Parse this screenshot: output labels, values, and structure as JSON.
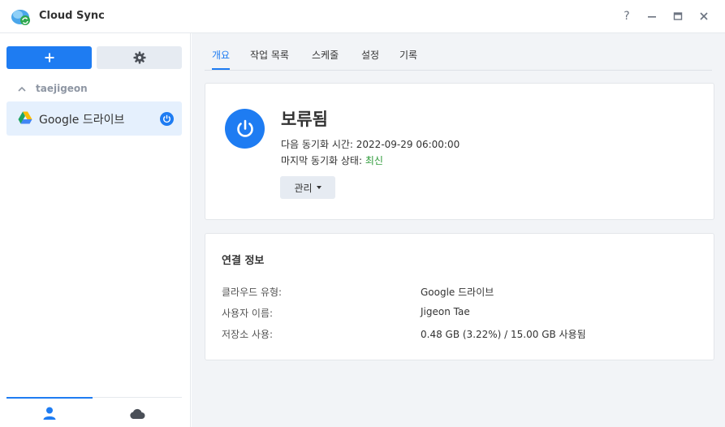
{
  "window": {
    "title": "Cloud Sync",
    "help_glyph": "?",
    "minimize_glyph": "—",
    "maximize_glyph": "▭",
    "close_glyph": "✕"
  },
  "sidebar": {
    "add_button_glyph": "+",
    "settings_icon": "gear-icon",
    "user_group": "taejigeon",
    "tasks": [
      {
        "label": "Google 드라이브",
        "icon": "google-drive-icon",
        "status_icon": "power-icon"
      }
    ],
    "bottom_tabs": [
      {
        "icon": "user-icon",
        "active": true
      },
      {
        "icon": "cloud-icon",
        "active": false
      }
    ]
  },
  "main": {
    "tabs": [
      {
        "label": "개요",
        "active": true
      },
      {
        "label": "작업 목록",
        "active": false
      },
      {
        "label": "스케줄",
        "active": false
      },
      {
        "label": "설정",
        "active": false
      },
      {
        "label": "기록",
        "active": false
      }
    ],
    "summary": {
      "status": "보류됨",
      "next_sync_label": "다음 동기화 시간:",
      "next_sync_value": "2022-09-29 06:00:00",
      "last_sync_label": "마지막 동기화 상태:",
      "last_sync_value": "최신",
      "manage_label": "관리"
    },
    "connection": {
      "title": "연결 정보",
      "rows": [
        {
          "label": "클라우드 유형:",
          "value": "Google 드라이브"
        },
        {
          "label": "사용자 이름:",
          "value": "Jigeon Tae"
        },
        {
          "label": "저장소 사용:",
          "value": "0.48 GB (3.22%) / 15.00 GB 사용됨"
        }
      ]
    }
  },
  "colors": {
    "accent": "#1e7cf2",
    "ok": "#2e9b3a",
    "selected_bg": "#e5f0fd"
  }
}
